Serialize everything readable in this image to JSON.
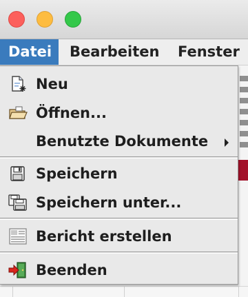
{
  "window": {
    "controls": [
      {
        "icon": "close-light",
        "color": "#fc605c"
      },
      {
        "icon": "minimize-light",
        "color": "#fdbc40"
      },
      {
        "icon": "zoom-light",
        "color": "#34c84a"
      }
    ]
  },
  "menubar": {
    "items": [
      {
        "label": "Datei",
        "active": true
      },
      {
        "label": "Bearbeiten"
      },
      {
        "label": "Fenster"
      }
    ],
    "accent": "#3a7bbd"
  },
  "menu": {
    "groups": [
      {
        "items": [
          {
            "label": "Neu",
            "icon": "new-document-icon"
          },
          {
            "label": "Öffnen...",
            "icon": "open-folder-icon"
          },
          {
            "label": "Benutzte Dokumente",
            "icon": "",
            "submenu": true
          }
        ]
      },
      {
        "items": [
          {
            "label": "Speichern",
            "icon": "floppy-disk-icon"
          },
          {
            "label": "Speichern unter...",
            "icon": "save-as-icon"
          }
        ]
      },
      {
        "items": [
          {
            "label": "Bericht erstellen",
            "icon": "report-icon"
          }
        ]
      },
      {
        "items": [
          {
            "label": "Beenden",
            "icon": "exit-door-icon"
          }
        ]
      }
    ]
  }
}
